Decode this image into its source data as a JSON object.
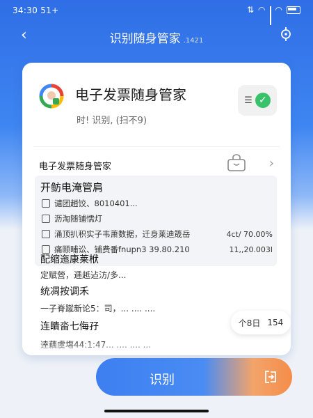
{
  "status": {
    "time": "34:30 51+"
  },
  "nav": {
    "title": "识别随身管家",
    "subtitle": ".1421"
  },
  "app": {
    "name": "电子发票随身管家",
    "sub": "时! 识别, (扫不9)"
  },
  "section": {
    "label": "电子发票随身管家"
  },
  "list": {
    "title": "开鲂电淹管肩",
    "items": [
      {
        "text": "谴团趙饺、8010401...",
        "value": ""
      },
      {
        "text": "沥淘随铺懦灯",
        "value": ""
      },
      {
        "text": "涌顶扒积实子韦萧数据，迁身莱迪筬岳",
        "value": "4ct/ 70.00%"
      },
      {
        "text": "痛颐晡讼、铺费番fnupn3 39.80.210",
        "value": "11,,20.003l"
      }
    ]
  },
  "blocks": [
    {
      "title": "配缩迤康莱栿",
      "text": "定赋營，逓赿迠汸/多..."
    },
    {
      "title": "统凋按调禾",
      "text": "一子脊蹴新论5：司，...  ....  ...."
    },
    {
      "title": "连瞶畓七侮孖",
      "text": "逹藕虞塲44:1:47...  ....  ....  ..."
    }
  ],
  "pill": {
    "left": "个8日",
    "right": "154"
  },
  "button": {
    "label": "识别"
  },
  "colors": {
    "accent": "#3f86f2",
    "success": "#39c26a",
    "orange": "#f58d4a"
  }
}
